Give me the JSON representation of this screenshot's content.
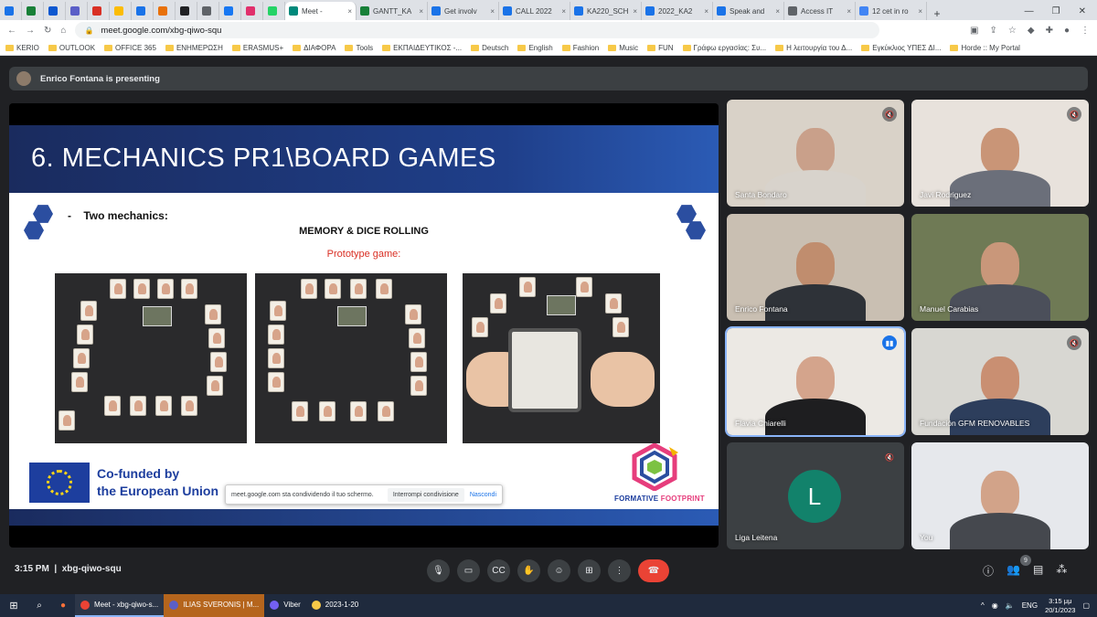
{
  "browser": {
    "tabs": [
      {
        "label": "",
        "color": "#1a73e8",
        "kind": "small"
      },
      {
        "label": "",
        "color": "#188038",
        "kind": "small"
      },
      {
        "label": "",
        "color": "#0b57d0",
        "kind": "small"
      },
      {
        "label": "",
        "color": "#5b5fc7",
        "kind": "small"
      },
      {
        "label": "",
        "color": "#d93025",
        "kind": "small"
      },
      {
        "label": "",
        "color": "#fbbc04",
        "kind": "small"
      },
      {
        "label": "",
        "color": "#1a73e8",
        "kind": "small"
      },
      {
        "label": "",
        "color": "#e8710a",
        "kind": "small"
      },
      {
        "label": "",
        "color": "#202124",
        "kind": "small"
      },
      {
        "label": "",
        "color": "#5f6368",
        "kind": "small"
      },
      {
        "label": "",
        "color": "#1877f2",
        "kind": "small"
      },
      {
        "label": "",
        "color": "#e1306c",
        "kind": "small"
      },
      {
        "label": "",
        "color": "#25d366",
        "kind": "small"
      },
      {
        "label": "Meet -",
        "color": "#00897b",
        "kind": "active"
      },
      {
        "label": "GANTT_KA",
        "color": "#188038",
        "kind": "normal"
      },
      {
        "label": "Get involv",
        "color": "#1a73e8",
        "kind": "normal"
      },
      {
        "label": "CALL 2022",
        "color": "#1a73e8",
        "kind": "normal"
      },
      {
        "label": "KA220_SCH",
        "color": "#1a73e8",
        "kind": "normal"
      },
      {
        "label": "2022_KA2",
        "color": "#1a73e8",
        "kind": "normal"
      },
      {
        "label": "Speak and",
        "color": "#1a73e8",
        "kind": "normal"
      },
      {
        "label": "Access IT",
        "color": "#5f6368",
        "kind": "normal"
      },
      {
        "label": "12 cet in ro",
        "color": "#4285f4",
        "kind": "normal"
      }
    ],
    "url": "meet.google.com/xbg-qiwo-squ",
    "bookmarks": [
      "KERIO",
      "OUTLOOK",
      "OFFICE 365",
      "ΕΝΗΜΕΡΩΣΗ",
      "ERASMUS+",
      "ΔΙΑΦΟΡΑ",
      "Tools",
      "ΕΚΠΑΙΔΕΥΤΙΚΟΣ -...",
      "Deutsch",
      "English",
      "Fashion",
      "Music",
      "FUN",
      "Γράφω εργασίας: Συ...",
      "Η λειτουργία του Δ...",
      "Εγκύκλιος ΥΠΕΣ ΔΙ...",
      "Horde :: My Portal"
    ]
  },
  "meet": {
    "presenting_banner": "Enrico Fontana is presenting",
    "time": "3:15 PM",
    "meeting_code": "xbg-qiwo-squ",
    "people_badge": "9",
    "share_notice": {
      "message": "meet.google.com sta condividendo il tuo schermo.",
      "stop_label": "Interrompi condivisione",
      "hide_label": "Nascondi"
    }
  },
  "slide": {
    "title": "6. MECHANICS PR1\\BOARD GAMES",
    "bullet": "Two mechanics:",
    "subtitle": "MEMORY & DICE ROLLING",
    "prototype_label": "Prototype game:",
    "eu_line1": "Co-funded by",
    "eu_line2": "the European Union",
    "logo_text_a": "FORMATIVE",
    "logo_text_b": "FOOTPRINT"
  },
  "participants": [
    {
      "name": "Santa Bondaro",
      "muted": true,
      "bg": "#d9d2c8",
      "head": "#c9a08a",
      "body": "#d8d3cc"
    },
    {
      "name": "Javi Rodriguez",
      "muted": true,
      "bg": "#e8e2dc",
      "head": "#c99577",
      "body": "#6b6f7a"
    },
    {
      "name": "Enrico Fontana",
      "muted": false,
      "bg": "#c9bfb2",
      "head": "#c08d6e",
      "body": "#2e3238"
    },
    {
      "name": "Manuel Carabias",
      "muted": false,
      "bg": "#6f7a55",
      "head": "#c9977a",
      "body": "#4b4f5a"
    },
    {
      "name": "Flavia Chiarelli",
      "muted": false,
      "speaking": true,
      "bg": "#ece9e4",
      "head": "#d4a48c",
      "body": "#1e1e20"
    },
    {
      "name": "Fundación GFM RENOVABLES",
      "muted": true,
      "bg": "#d8d7d2",
      "head": "#c98f72",
      "body": "#2d3e5c"
    },
    {
      "name": "Liga Leitena",
      "muted": true,
      "avatar_letter": "L",
      "avatar_color": "#12826b"
    },
    {
      "name": "You",
      "muted": false,
      "bg": "#e6e8ec",
      "head": "#d2a389",
      "body": "#45484e"
    }
  ],
  "taskbar": {
    "apps": [
      {
        "label": "Meet - xbg-qiwo-s...",
        "color": "#ea4335",
        "state": "open"
      },
      {
        "label": "ILIAS SVERONIS | M...",
        "color": "#5b5fc7",
        "state": "highlight"
      },
      {
        "label": "Viber",
        "color": "#7360f2",
        "state": "plain"
      },
      {
        "label": "2023-1-20",
        "color": "#f7c948",
        "state": "plain"
      }
    ],
    "language": "ENG",
    "clock_time": "3:15 μμ",
    "clock_date": "20/1/2023"
  }
}
